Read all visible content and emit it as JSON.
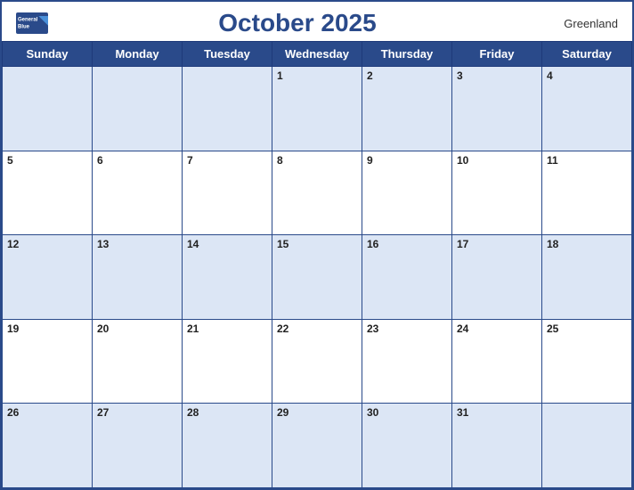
{
  "header": {
    "brand": "General",
    "brand2": "Blue",
    "title": "October 2025",
    "region": "Greenland"
  },
  "days_of_week": [
    "Sunday",
    "Monday",
    "Tuesday",
    "Wednesday",
    "Thursday",
    "Friday",
    "Saturday"
  ],
  "weeks": [
    [
      null,
      null,
      null,
      1,
      2,
      3,
      4
    ],
    [
      5,
      6,
      7,
      8,
      9,
      10,
      11
    ],
    [
      12,
      13,
      14,
      15,
      16,
      17,
      18
    ],
    [
      19,
      20,
      21,
      22,
      23,
      24,
      25
    ],
    [
      26,
      27,
      28,
      29,
      30,
      31,
      null
    ]
  ]
}
